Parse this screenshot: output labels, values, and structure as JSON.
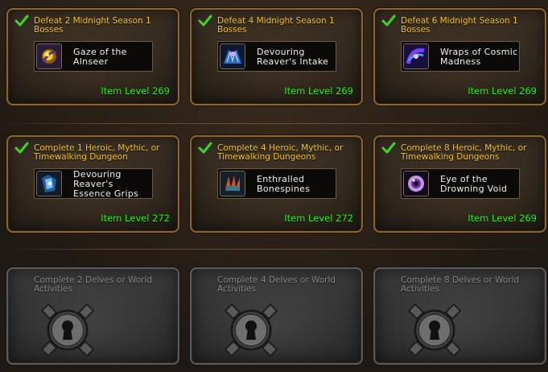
{
  "colors": {
    "title_gold": "#f5c518",
    "item_level_green": "#1eff00",
    "locked_text_gray": "#858585",
    "card_border_gold": "#8a6631",
    "card_border_gray": "#5b5b5b"
  },
  "rows": [
    {
      "cards": [
        {
          "state": "completed",
          "check_icon": "checkmark-icon",
          "title": "Defeat 2 Midnight Season 1 Bosses",
          "reward_icon": "gaze-of-the-alnseer-icon",
          "reward_name": "Gaze of the Alnseer",
          "item_level": "Item Level 269"
        },
        {
          "state": "completed",
          "check_icon": "checkmark-icon",
          "title": "Defeat 4 Midnight Season 1 Bosses",
          "reward_icon": "devouring-reavers-intake-icon",
          "reward_name": "Devouring Reaver's Intake",
          "item_level": "Item Level 269"
        },
        {
          "state": "completed",
          "check_icon": "checkmark-icon",
          "title": "Defeat 6 Midnight Season 1 Bosses",
          "reward_icon": "wraps-of-cosmic-madness-icon",
          "reward_name": "Wraps of Cosmic Madness",
          "item_level": "Item Level 269"
        }
      ]
    },
    {
      "cards": [
        {
          "state": "completed",
          "check_icon": "checkmark-icon",
          "title": "Complete 1 Heroic, Mythic, or Timewalking Dungeon",
          "reward_icon": "devouring-reavers-essence-grips-icon",
          "reward_name": "Devouring Reaver's Essence Grips",
          "item_level": "Item Level 272"
        },
        {
          "state": "completed",
          "check_icon": "checkmark-icon",
          "title": "Complete 4 Heroic, Mythic, or Timewalking Dungeons",
          "reward_icon": "enthralled-bonespines-icon",
          "reward_name": "Enthralled Bonespines",
          "item_level": "Item Level 272"
        },
        {
          "state": "completed",
          "check_icon": "checkmark-icon",
          "title": "Complete 8 Heroic, Mythic, or Timewalking Dungeons",
          "reward_icon": "eye-of-the-drowning-void-icon",
          "reward_name": "Eye of the Drowning Void",
          "item_level": "Item Level 269"
        }
      ]
    },
    {
      "cards": [
        {
          "state": "locked",
          "title": "Complete 2 Delves or World Activities",
          "lock_icon": "keyhole-lock-icon"
        },
        {
          "state": "locked",
          "title": "Complete 4 Delves or World Activities",
          "lock_icon": "keyhole-lock-icon"
        },
        {
          "state": "locked",
          "title": "Complete 8 Delves or World Activities",
          "lock_icon": "keyhole-lock-icon"
        }
      ]
    }
  ]
}
